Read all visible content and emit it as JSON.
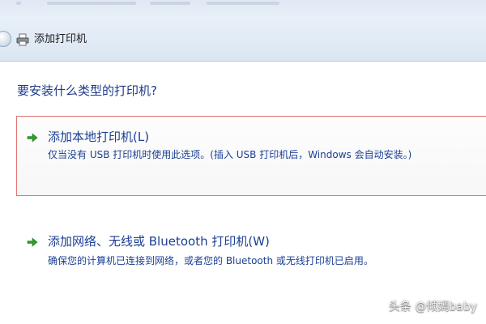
{
  "window": {
    "title": "添加打印机"
  },
  "main": {
    "question": "要安装什么类型的打印机?",
    "options": [
      {
        "title": "添加本地打印机(L)",
        "description": "仅当没有 USB 打印机时使用此选项。(插入 USB 打印机后，Windows 会自动安装。)",
        "icon": "green-arrow-icon",
        "selected": true
      },
      {
        "title": "添加网络、无线或 Bluetooth 打印机(W)",
        "description": "确保您的计算机已连接到网络，或者您的 Bluetooth 或无线打印机已启用。",
        "icon": "green-arrow-icon",
        "selected": false
      }
    ]
  },
  "watermark": {
    "text": "头条 @倾嫣baby"
  },
  "colors": {
    "link_text": "#1c3f94",
    "selected_border": "#e07373",
    "arrow_green": "#2f9e2f"
  }
}
